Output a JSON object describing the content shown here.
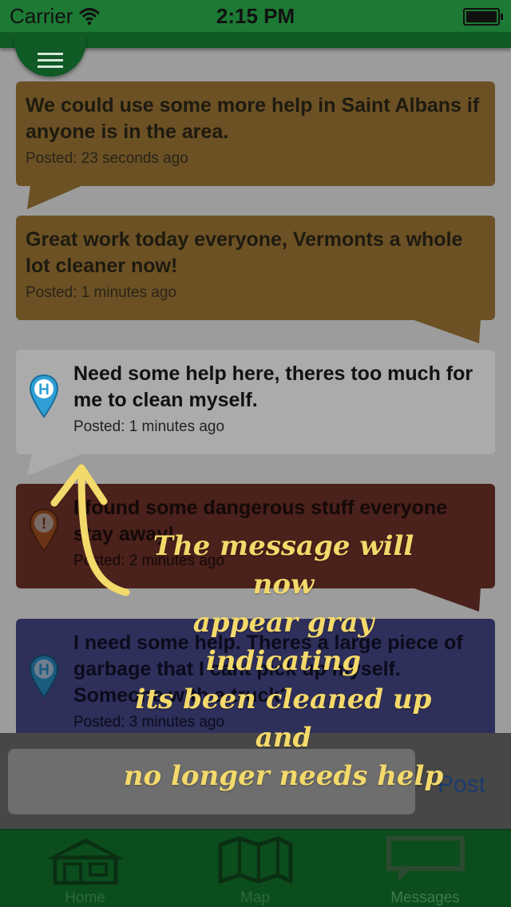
{
  "status_bar": {
    "carrier": "Carrier",
    "time": "2:15 PM"
  },
  "messages": [
    {
      "text": "We could use some more help in Saint Albans if anyone is in the area.",
      "posted": "Posted: 23 seconds ago",
      "pin": "none",
      "color": "#6b5124"
    },
    {
      "text": "Great work today everyone, Vermonts a whole lot cleaner now!",
      "posted": "Posted: 1 minutes ago",
      "pin": "none",
      "color": "#6b5124"
    },
    {
      "text": "Need some help here, theres too much for me to clean myself.",
      "posted": "Posted: 1 minutes ago",
      "pin": "help-pin",
      "pin_letter": "H",
      "color": "#ababab"
    },
    {
      "text": "I found some dangerous stuff everyone stay away!",
      "posted": "Posted: 2 minutes ago",
      "pin": "danger-pin",
      "pin_letter": "!",
      "color": "#4a211b"
    },
    {
      "text": "I need some help. Theres a large piece of garbage that I cant pick up myself. Someone with a truck?",
      "posted": "Posted: 3 minutes ago",
      "pin": "help-pin",
      "pin_letter": "H",
      "color": "#2e2f5a"
    }
  ],
  "compose": {
    "placeholder": "",
    "post_label": "Post"
  },
  "tabs": [
    {
      "label": "Home",
      "icon": "house-icon"
    },
    {
      "label": "Map",
      "icon": "map-icon"
    },
    {
      "label": "Messages",
      "icon": "chat-bubble-icon",
      "active": true
    }
  ],
  "annotation": {
    "lines": [
      "The message will now",
      "appear gray indicating",
      "its been cleaned up and",
      "no longer needs help"
    ],
    "color": "#f4d96b"
  }
}
